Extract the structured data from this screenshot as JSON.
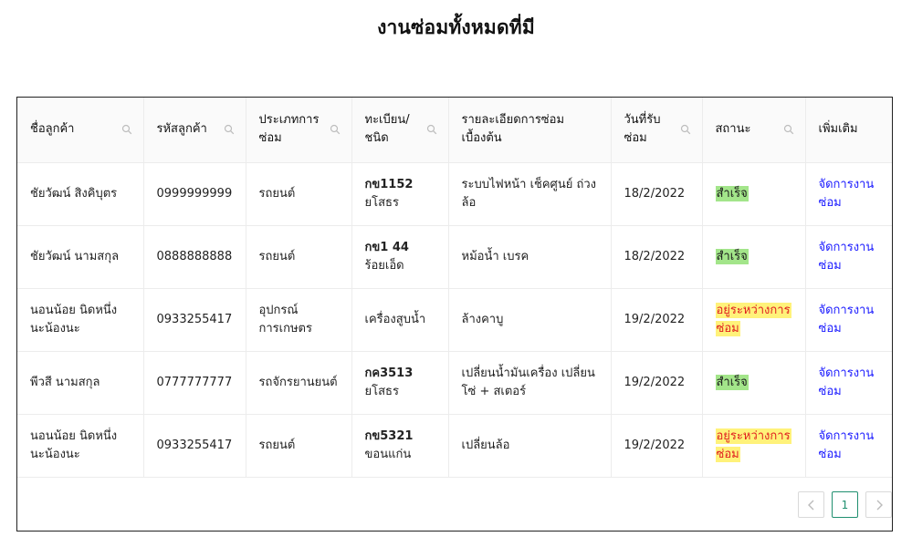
{
  "page": {
    "title": "งานซ่อมทั้งหมดที่มี"
  },
  "table": {
    "columns": [
      {
        "label": "ชื่อลูกค้า",
        "icon": "search-icon"
      },
      {
        "label": "รหัสลูกค้า",
        "icon": "search-icon"
      },
      {
        "label": "ประเภทการซ่อม",
        "icon": "search-icon"
      },
      {
        "label": "ทะเบียน/ชนิด",
        "icon": "search-icon"
      },
      {
        "label": "รายละเอียดการซ่อมเบื้องต้น",
        "icon": null
      },
      {
        "label": "วันที่รับซ่อม",
        "icon": "search-icon"
      },
      {
        "label": "สถานะ",
        "icon": "search-icon"
      },
      {
        "label": "เพิ่มเติม",
        "icon": null
      }
    ],
    "rows": [
      {
        "name": "ชัยวัฒน์ สิงคิบุตร",
        "code": "0999999999",
        "type": "รถยนต์",
        "plate": "กข1152",
        "province": "ยโสธร",
        "detail": "ระบบไฟหน้า เช็คศูนย์ ถ่วงล้อ",
        "date": "18/2/2022",
        "status": "สำเร็จ",
        "status_kind": "done",
        "action": "จัดการงานซ่อม"
      },
      {
        "name": "ชัยวัฒน์ นามสกุล",
        "code": "0888888888",
        "type": "รถยนต์",
        "plate": "กข1 44",
        "province": "ร้อยเอ็ด",
        "detail": "หม้อน้ำ เบรค",
        "date": "18/2/2022",
        "status": "สำเร็จ",
        "status_kind": "done",
        "action": "จัดการงานซ่อม"
      },
      {
        "name": "นอนน้อย นิดหนึ่งนะน้องนะ",
        "code": "0933255417",
        "type": "อุปกรณ์การเกษตร",
        "plate": "",
        "province": "เครื่องสูบน้ำ",
        "detail": "ล้างคาบู",
        "date": "19/2/2022",
        "status": "อยู่ระหว่างการซ่อม",
        "status_kind": "progress",
        "action": "จัดการงานซ่อม"
      },
      {
        "name": "พีวสี นามสกุล",
        "code": "0777777777",
        "type": "รถจักรยานยนต์",
        "plate": "กค3513",
        "province": "ยโสธร",
        "detail": "เปลี่ยนน้ำมันเครื่อง เปลี่ยนโซ่ + สเตอร์",
        "date": "19/2/2022",
        "status": "สำเร็จ",
        "status_kind": "done",
        "action": "จัดการงานซ่อม"
      },
      {
        "name": "นอนน้อย นิดหนึ่งนะน้องนะ",
        "code": "0933255417",
        "type": "รถยนต์",
        "plate": "กข5321",
        "province": "ขอนแก่น",
        "detail": "เปลี่ยนล้อ",
        "date": "19/2/2022",
        "status": "อยู่ระหว่างการซ่อม",
        "status_kind": "progress",
        "action": "จัดการงานซ่อม"
      }
    ]
  },
  "pagination": {
    "prev": "‹",
    "current": "1",
    "next": "›"
  },
  "colors": {
    "done": "#a3e58a",
    "progress_bg": "#fff27a",
    "progress_text": "#e02020",
    "link": "#1a1aff",
    "page_active": "#1f8f6f"
  }
}
